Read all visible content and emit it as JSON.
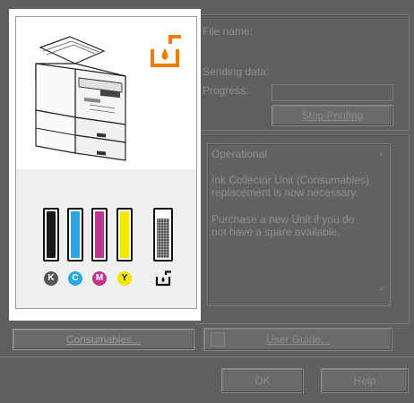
{
  "file_name_label": "File name:",
  "sending_data_label": "Sending data:",
  "progress_label": "Progress:",
  "stop_printing_label": "Stop Printing",
  "status": {
    "title": "Operational",
    "line1": "Ink Collector Unit (Consumables)",
    "line2": "replacement is now necessary.",
    "line3": "Purchase a new Unit if you do",
    "line4": "not have a spare available."
  },
  "consumables_label": "Consumables...",
  "user_guide_label": "User Guide...",
  "ok_label": "OK",
  "help_label": "Help",
  "ink": {
    "k_label": "K",
    "c_label": "C",
    "m_label": "M",
    "y_label": "Y",
    "colors": {
      "k": "#1a1a1a",
      "c": "#29a8e0",
      "m": "#c0348f",
      "y": "#f3e600"
    }
  },
  "icons": [
    "printer-illustration-icon",
    "ink-collector-alert-icon",
    "ink-collector-icon",
    "user-guide-icon"
  ],
  "accent_color": "#f07d00"
}
